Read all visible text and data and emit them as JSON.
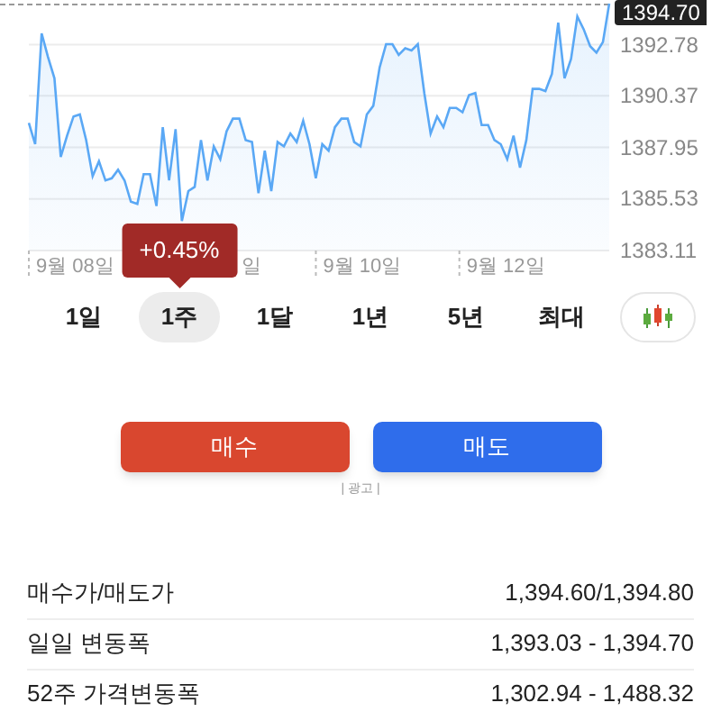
{
  "chart": {
    "chart_data": {
      "type": "area",
      "grid": true,
      "series": [
        {
          "color": "#5aa8f5",
          "values": [
            1389.1,
            1388.1,
            1393.3,
            1392.2,
            1391.2,
            1387.5,
            1388.5,
            1389.4,
            1389.5,
            1388.3,
            1386.6,
            1387.3,
            1386.4,
            1386.5,
            1386.9,
            1386.4,
            1385.4,
            1385.3,
            1386.7,
            1386.7,
            1385.2,
            1388.9,
            1386.4,
            1388.8,
            1384.5,
            1385.9,
            1386.1,
            1388.3,
            1386.4,
            1388.0,
            1387.4,
            1388.7,
            1389.3,
            1389.3,
            1388.3,
            1388.2,
            1385.8,
            1387.8,
            1385.9,
            1388.2,
            1388.0,
            1388.6,
            1388.2,
            1389.2,
            1388.1,
            1386.5,
            1388.1,
            1387.8,
            1388.9,
            1389.3,
            1389.3,
            1388.2,
            1388.0,
            1389.5,
            1389.9,
            1391.7,
            1392.8,
            1392.8,
            1392.3,
            1392.6,
            1392.5,
            1392.8,
            1390.5,
            1388.6,
            1389.4,
            1388.9,
            1389.8,
            1389.8,
            1389.6,
            1390.4,
            1390.5,
            1389.0,
            1389.0,
            1388.3,
            1388.1,
            1387.4,
            1388.5,
            1387.0,
            1388.3,
            1390.7,
            1390.7,
            1390.6,
            1391.4,
            1393.8,
            1391.2,
            1392.1,
            1394.1,
            1393.5,
            1392.7,
            1392.4,
            1392.9,
            1394.7
          ]
        }
      ],
      "ylim": [
        1383.11,
        1394.7
      ],
      "yticks": [
        {
          "value": 1383.11,
          "label": "1383.11"
        },
        {
          "value": 1385.53,
          "label": "1385.53"
        },
        {
          "value": 1387.95,
          "label": "1387.95"
        },
        {
          "value": 1390.37,
          "label": "1390.37"
        },
        {
          "value": 1392.78,
          "label": "1392.78"
        }
      ]
    },
    "current_price": "1394.70",
    "date_labels": [
      "9월 08일",
      "일",
      "9월 10일",
      "9월 12일"
    ],
    "tooltip": "+0.45%"
  },
  "periods": [
    {
      "label": "1일",
      "selected": false
    },
    {
      "label": "1주",
      "selected": true
    },
    {
      "label": "1달",
      "selected": false
    },
    {
      "label": "1년",
      "selected": false
    },
    {
      "label": "5년",
      "selected": false
    },
    {
      "label": "최대",
      "selected": false
    }
  ],
  "buttons": [
    {
      "label": "매수",
      "kind": "buy"
    },
    {
      "label": "매도",
      "kind": "sell"
    }
  ],
  "ad_label": "| 광고 |",
  "stats": [
    {
      "label": "매수가/매도가",
      "value": "1,394.60/1,394.80"
    },
    {
      "label": "일일 변동폭",
      "value": "1,393.03 - 1,394.70"
    },
    {
      "label": "52주 가격변동폭",
      "value": "1,302.94 - 1,488.32"
    }
  ]
}
